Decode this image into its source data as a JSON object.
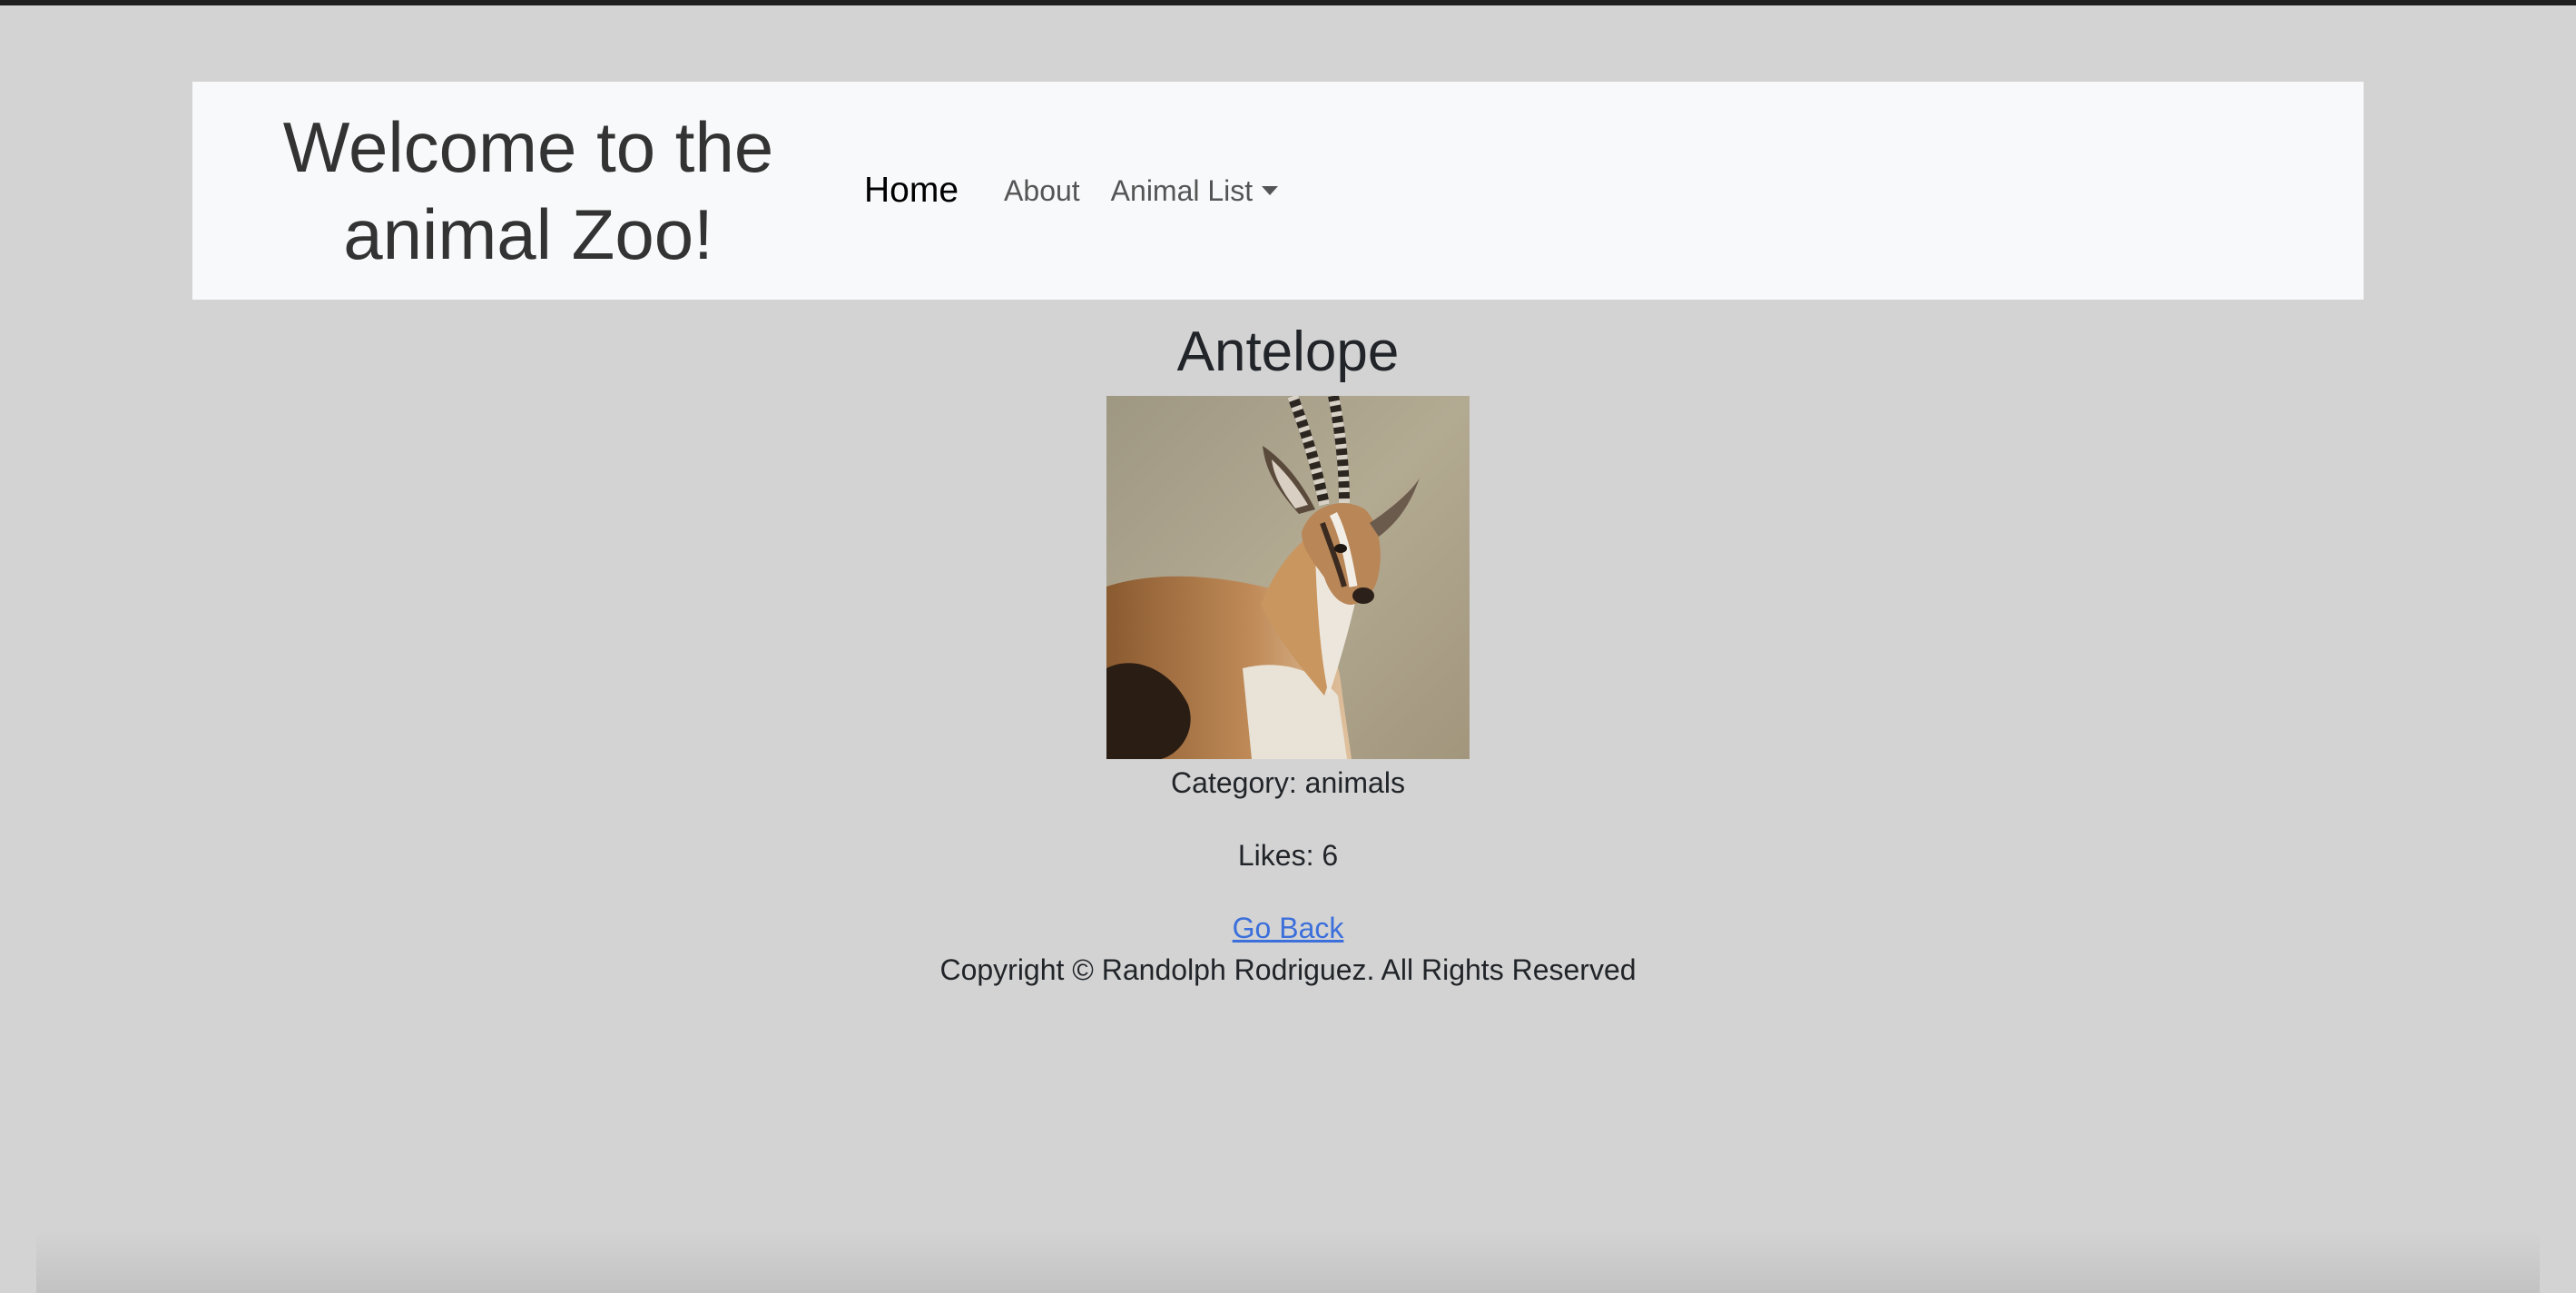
{
  "header": {
    "brand_title": "Welcome to the animal Zoo!",
    "nav": {
      "home": "Home",
      "about": "About",
      "animal_list": "Animal List"
    }
  },
  "animal": {
    "name": "Antelope",
    "image_alt": "Antelope",
    "category_text": "Category: animals",
    "likes_text": "Likes: 6"
  },
  "links": {
    "go_back": "Go Back"
  },
  "footer": {
    "copyright": "Copyright © Randolph Rodriguez. All Rights Reserved"
  },
  "colors": {
    "page_background": "#d3d3d3",
    "navbar_background": "#f8f9fa",
    "link": "#3b6fdb"
  }
}
